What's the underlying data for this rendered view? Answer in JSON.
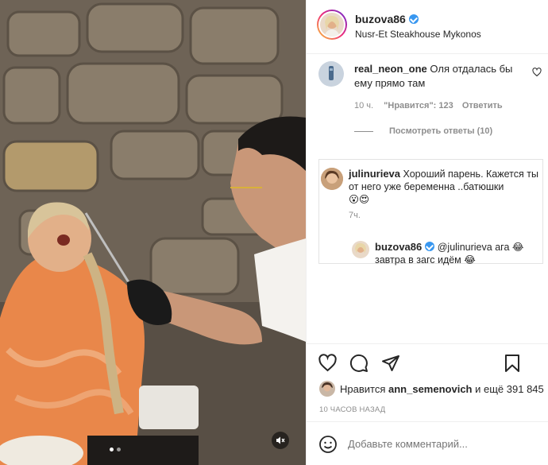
{
  "header": {
    "username": "buzova86",
    "location": "Nusr-Et Steakhouse Mykonos"
  },
  "comment1": {
    "username": "real_neon_one",
    "text": "Оля отдалась бы ему прямо там",
    "time": "10 ч.",
    "likes": "\"Нравится\": 123",
    "reply_label": "Ответить",
    "view_replies": "Посмотреть ответы (10)"
  },
  "comment2": {
    "username": "julinurieva",
    "text": "Хороший парень. Кажется ты от него уже беременна ..батюшки",
    "emoji": "😮😍",
    "time": "7ч."
  },
  "reply": {
    "username": "buzova86",
    "mention": "@julinurieva",
    "text1": "ага 😂",
    "text2": "завтра в загс идём 😂"
  },
  "likes": {
    "prefix": "Нравится",
    "user": "ann_semenovich",
    "suffix": "и ещё 391 845"
  },
  "timestamp": "10 ЧАСОВ НАЗАД",
  "comment_input": {
    "placeholder": "Добавьте комментарий..."
  },
  "colors": {
    "verified": "#3897f0",
    "meta_gray": "#8e8e8e"
  }
}
